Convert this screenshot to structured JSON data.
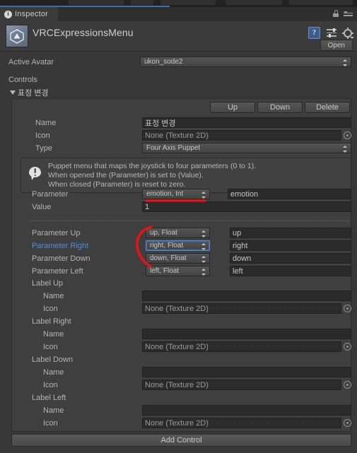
{
  "window": {
    "tab_label": "Inspector",
    "tab_icon": "info-icon",
    "lock_icon": "lock-icon",
    "menu_icon": "hamburger-menu-icon",
    "accent_color": "#3a6ea8"
  },
  "asset_header": {
    "title": "VRCExpressionsMenu",
    "asset_icon": "scriptable-object-icon",
    "help_icon": "help-icon",
    "preset_icon": "preset-icon",
    "settings_icon": "gear-icon",
    "open_button": "Open"
  },
  "fields": {
    "active_avatar_label": "Active Avatar",
    "active_avatar_value": "ukon_sode2",
    "controls_label": "Controls",
    "control_foldout": "표정 변경"
  },
  "control_buttons": {
    "up": "Up",
    "down": "Down",
    "delete": "Delete"
  },
  "control": {
    "name_label": "Name",
    "name_value": "표정 변경",
    "icon_label": "Icon",
    "icon_value": "None (Texture 2D)",
    "type_label": "Type",
    "type_value": "Four Axis Puppet",
    "help_text": "Puppet menu that maps the joystick to four parameters (0 to 1).\nWhen opened the (Parameter) is set to (Value).\nWhen closed (Parameter) is reset to zero.",
    "parameter_label": "Parameter",
    "parameter_value": "emotion, Int",
    "parameter_name": "emotion",
    "value_label": "Value",
    "value_value": "1"
  },
  "axis_params": [
    {
      "label": "Parameter Up",
      "dropdown": "up, Float",
      "name": "up",
      "highlighted": false
    },
    {
      "label": "Parameter Right",
      "dropdown": "right, Float",
      "name": "right",
      "highlighted": true
    },
    {
      "label": "Parameter Down",
      "dropdown": "down, Float",
      "name": "down",
      "highlighted": false
    },
    {
      "label": "Parameter Left",
      "dropdown": "left, Float",
      "name": "left",
      "highlighted": false
    }
  ],
  "labels": [
    {
      "group": "Label Up",
      "name_label": "Name",
      "name_value": "",
      "icon_label": "Icon",
      "icon_value": "None (Texture 2D)"
    },
    {
      "group": "Label Right",
      "name_label": "Name",
      "name_value": "",
      "icon_label": "Icon",
      "icon_value": "None (Texture 2D)"
    },
    {
      "group": "Label Down",
      "name_label": "Name",
      "name_value": "",
      "icon_label": "Icon",
      "icon_value": "None (Texture 2D)"
    },
    {
      "group": "Label Left",
      "name_label": "Name",
      "name_value": "",
      "icon_label": "Icon",
      "icon_value": "None (Texture 2D)"
    }
  ],
  "footer": {
    "add_control": "Add Control"
  },
  "annotations": {
    "underline_color": "#ee1111",
    "arc_color": "#ee1111"
  }
}
